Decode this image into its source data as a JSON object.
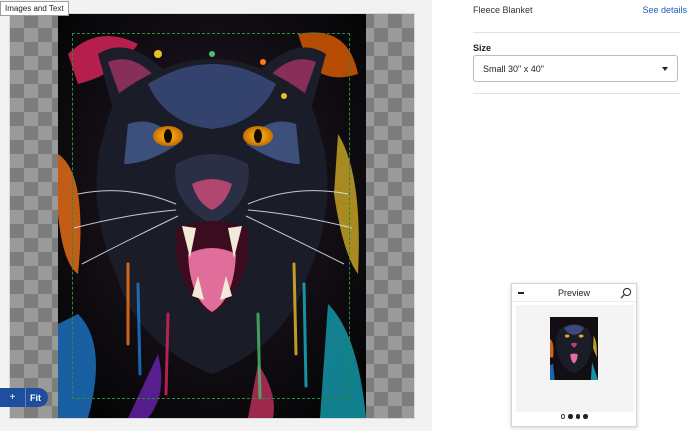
{
  "editor": {
    "tooltip": "Images and Text",
    "zoom": {
      "plus_label": "+",
      "fit_label": "Fit"
    }
  },
  "panel": {
    "product_name": "Fleece Blanket",
    "details_link": "See details",
    "size_label": "Size",
    "size_value": "Small 30\" x 40\""
  },
  "preview": {
    "title": "Preview",
    "pages": 4,
    "active_page": 1
  },
  "icons": {
    "search": "magnifier-icon",
    "minimize": "minus-icon",
    "dropdown": "caret-down-icon"
  },
  "colors": {
    "accent": "#1f4e9e",
    "link": "#1f5fbf",
    "safe_line": "#2f8a3a"
  }
}
